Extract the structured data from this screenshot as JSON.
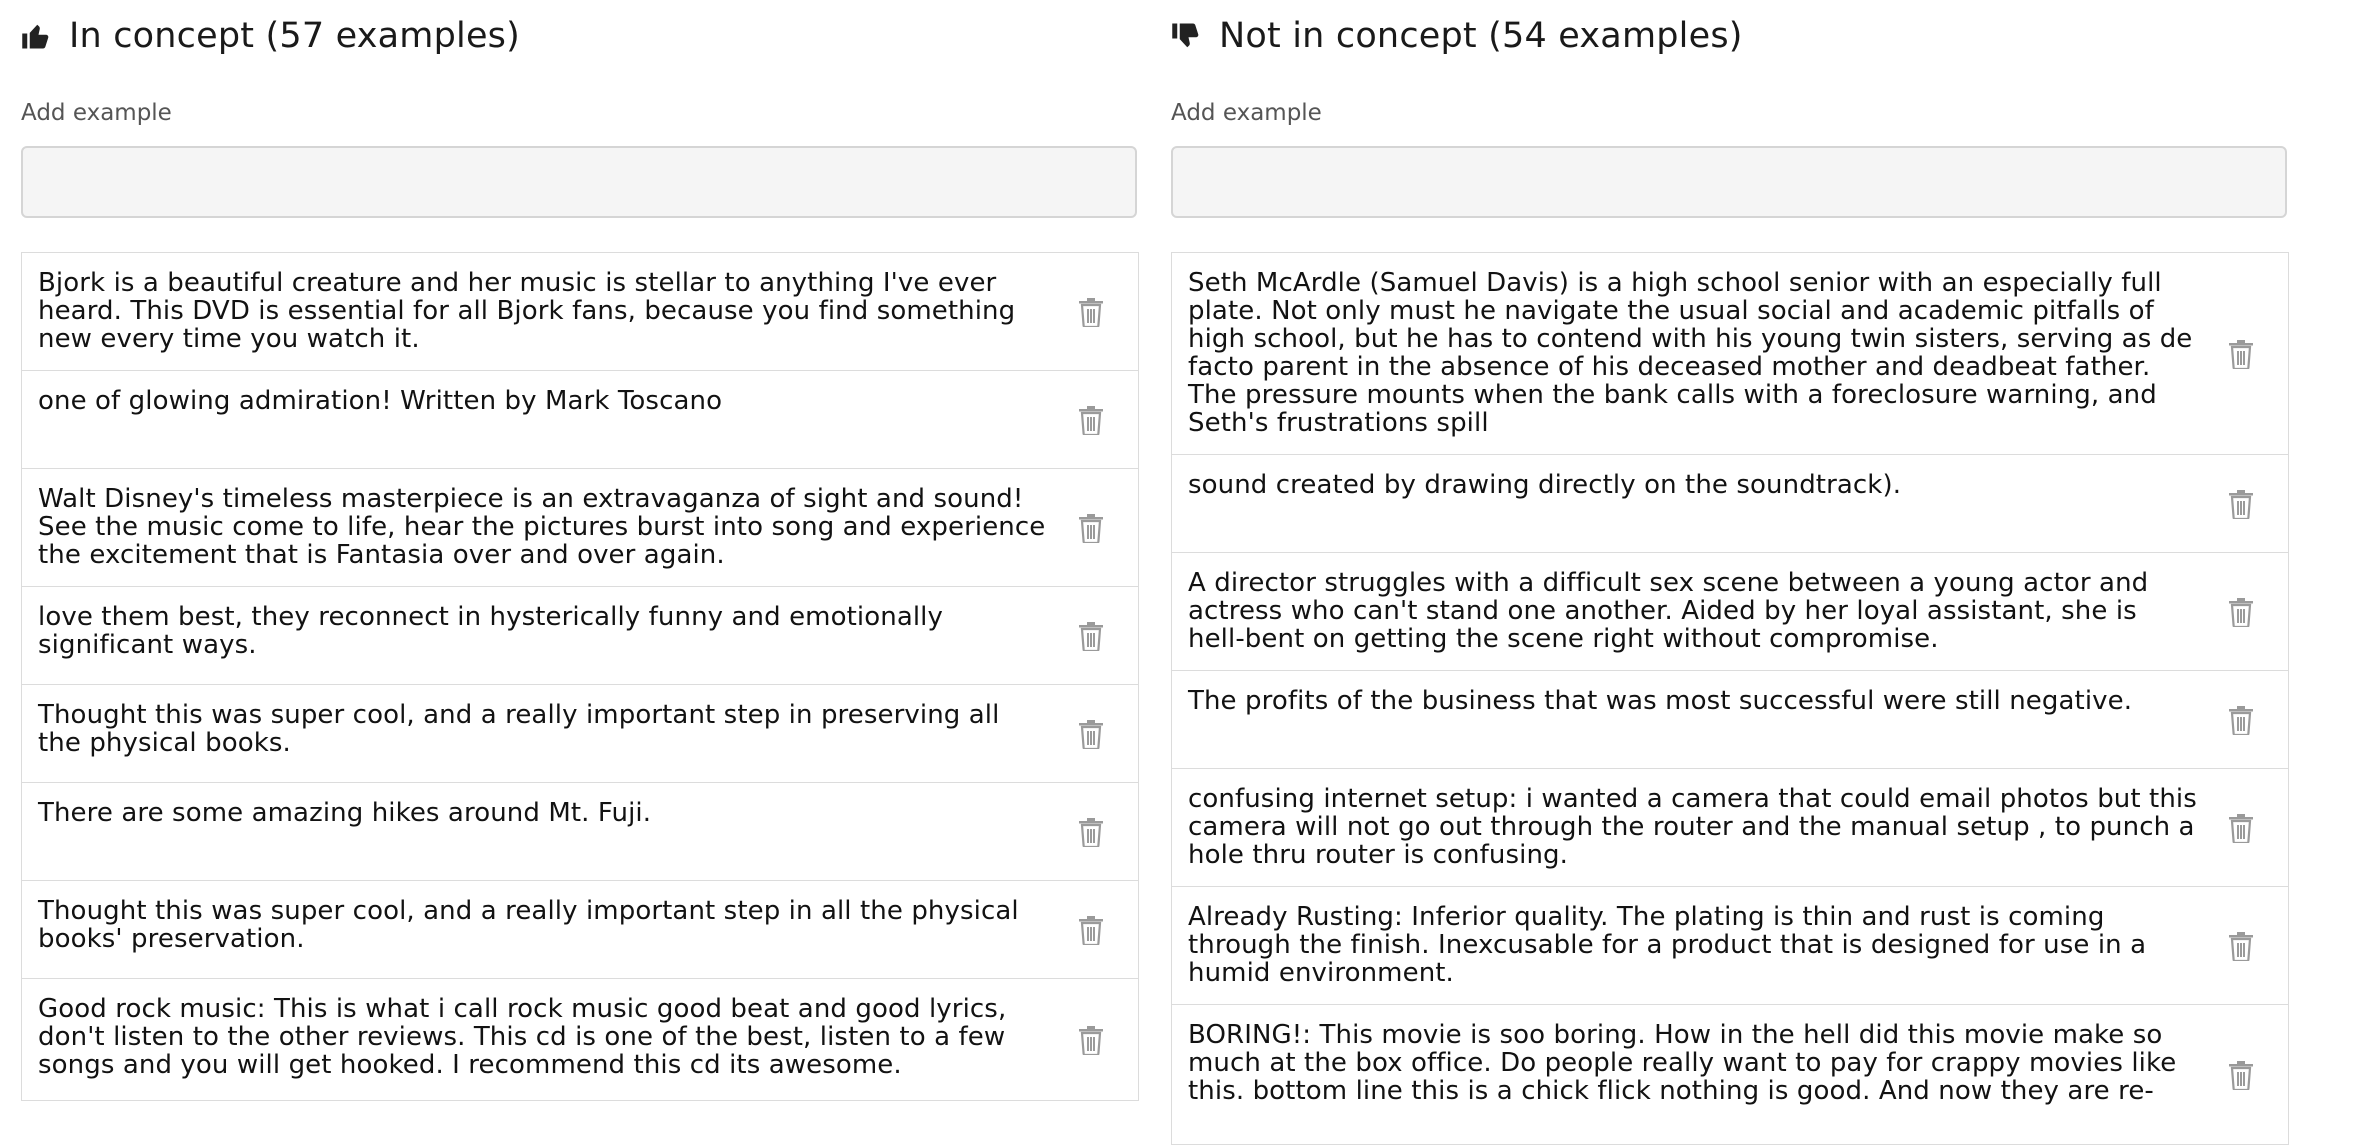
{
  "left": {
    "title": "In concept (57 examples)",
    "icon": "thumbs-up-icon",
    "add_label": "Add example",
    "add_placeholder": "",
    "examples": [
      "Bjork is a beautiful creature and her music is stellar to anything I've ever heard. This DVD is essential for all Bjork fans, because you find something new every time you watch it.",
      "one of glowing admiration! Written by Mark Toscano",
      "Walt Disney's timeless masterpiece is an extravaganza of sight and sound! See the music come to life, hear the pictures burst into song and experience the excitement that is Fantasia over and over again.",
      "love them best, they reconnect in hysterically funny and emotionally significant ways.",
      "Thought this was super cool, and a really important step in preserving all the physical books.",
      "There are some amazing hikes around Mt. Fuji.",
      "Thought this was super cool, and a really important step in all the physical books' preservation.",
      "Good rock music: This is what i call rock music good beat and good lyrics, don't listen to the other reviews. This cd is one of the best, listen to a few songs and you will get hooked. I recommend this cd its awesome."
    ]
  },
  "right": {
    "title": "Not in concept (54 examples)",
    "icon": "thumbs-down-icon",
    "add_label": "Add example",
    "add_placeholder": "",
    "examples": [
      "Seth McArdle (Samuel Davis) is a high school senior with an especially full plate. Not only must he navigate the usual social and academic pitfalls of high school, but he has to contend with his young twin sisters, serving as de facto parent in the absence of his deceased mother and deadbeat father. The pressure mounts when the bank calls with a foreclosure warning, and Seth's frustrations spill",
      "sound created by drawing directly on the soundtrack).",
      "A director struggles with a difficult sex scene between a young actor and actress who can't stand one another. Aided by her loyal assistant, she is hell-bent on getting the scene right without compromise.",
      "The profits of the business that was most successful were still negative.",
      "confusing internet setup: i wanted a camera that could email photos but this camera will not go out through the router and the manual setup , to punch a hole thru router is confusing.",
      "Already Rusting: Inferior quality. The plating is thin and rust is coming through the finish. Inexcusable for a product that is designed for use in a humid environment.",
      "BORING!: This movie is soo boring. How in the hell did this movie make so much at the box office. Do people really want to pay for crappy movies like this. bottom line this is a chick flick nothing is good. And now they are re-"
    ]
  }
}
